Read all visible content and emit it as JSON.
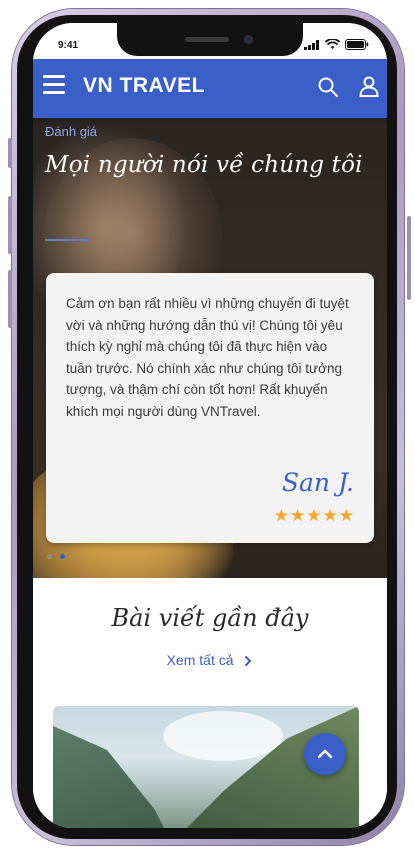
{
  "status_bar": {
    "time": "9:41"
  },
  "header": {
    "brand": "VN TRAVEL"
  },
  "testimonials": {
    "eyebrow": "Đánh giá",
    "title": "Mọi người nói về chúng tôi",
    "quote": "Cảm ơn bạn rất nhiều vì những chuyến đi tuyệt vời và những hướng dẫn thú vị! Chúng tôi yêu thích kỳ nghỉ mà chúng tôi đã thực hiện vào tuần trước. Nó chính xác như chúng tôi tưởng tượng, và thậm chí còn tốt hơn! Rất khuyến khích mọi người dùng VNTravel.",
    "author": "San J.",
    "rating_stars": 5,
    "slide_count": 2,
    "active_slide": 2
  },
  "recent_posts": {
    "title": "Bài viết gần đây",
    "see_all_label": "Xem tất cả"
  },
  "colors": {
    "brand_blue": "#3a5fc9",
    "star": "#f5a623"
  },
  "icons": {
    "menu": "menu-icon",
    "search": "search-icon",
    "user": "user-icon",
    "chevron_right": "chevron-right-icon",
    "chevron_up": "chevron-up-icon",
    "star": "star-icon"
  }
}
